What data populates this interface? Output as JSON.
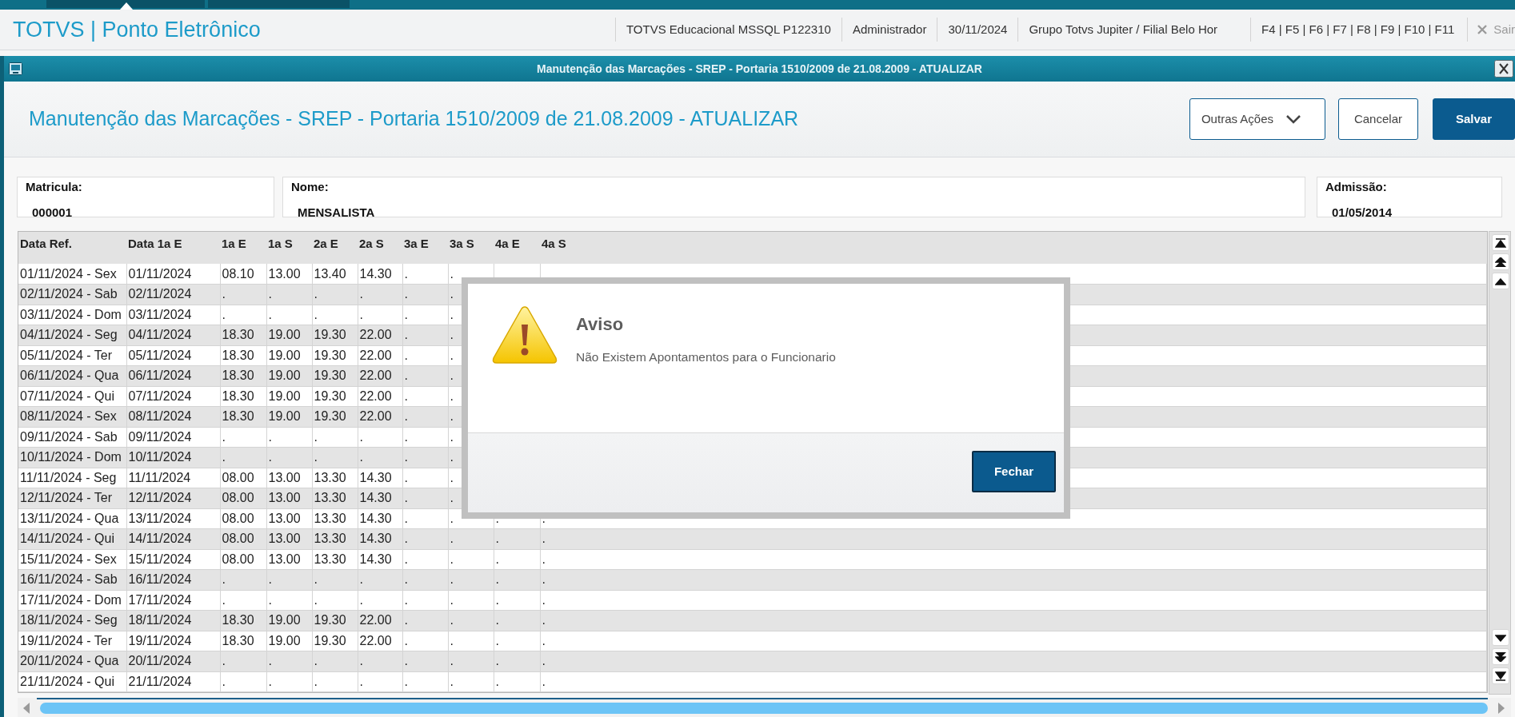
{
  "app": {
    "title": "TOTVS | Ponto Eletrônico",
    "info": [
      "TOTVS Educacional MSSQL P122310",
      "Administrador",
      "30/11/2024",
      "Grupo Totvs Jupiter / Filial Belo Hor",
      "F4 | F5 | F6 | F7 | F8 | F9 | F10 | F11"
    ],
    "exit": "Sair"
  },
  "window": {
    "title": "Manutenção das Marcações - SREP - Portaria 1510/2009 de 21.08.2009 - ATUALIZAR"
  },
  "form": {
    "title": "Manutenção das Marcações - SREP - Portaria 1510/2009 de 21.08.2009 - ATUALIZAR",
    "buttons": [
      {
        "label": "Outras Ações",
        "kind": "dropdown"
      },
      {
        "label": "Cancelar",
        "kind": "secondary"
      },
      {
        "label": "Salvar",
        "kind": "primary"
      }
    ]
  },
  "fields": [
    {
      "label": "Matricula:",
      "value": "000001"
    },
    {
      "label": "Nome:",
      "value": "MENSALISTA"
    },
    {
      "label": "Admissão:",
      "value": "01/05/2014"
    }
  ],
  "table": {
    "columns": [
      "Data Ref.",
      "Data 1a E",
      "1a E",
      "1a S",
      "2a E",
      "2a S",
      "3a E",
      "3a S",
      "4a E",
      "4a S"
    ],
    "rows": [
      [
        "01/11/2024 - Sex",
        "01/11/2024",
        "08.10",
        "13.00",
        "13.40",
        "14.30",
        ".",
        ".",
        null,
        null
      ],
      [
        "02/11/2024 - Sab",
        "02/11/2024",
        ".",
        ".",
        ".",
        ".",
        ".",
        ".",
        null,
        null
      ],
      [
        "03/11/2024 - Dom",
        "03/11/2024",
        ".",
        ".",
        ".",
        ".",
        ".",
        ".",
        null,
        null
      ],
      [
        "04/11/2024 - Seg",
        "04/11/2024",
        "18.30",
        "19.00",
        "19.30",
        "22.00",
        ".",
        ".",
        null,
        null
      ],
      [
        "05/11/2024 - Ter",
        "05/11/2024",
        "18.30",
        "19.00",
        "19.30",
        "22.00",
        ".",
        ".",
        null,
        null
      ],
      [
        "06/11/2024 - Qua",
        "06/11/2024",
        "18.30",
        "19.00",
        "19.30",
        "22.00",
        ".",
        ".",
        null,
        null
      ],
      [
        "07/11/2024 - Qui",
        "07/11/2024",
        "18.30",
        "19.00",
        "19.30",
        "22.00",
        ".",
        ".",
        null,
        null
      ],
      [
        "08/11/2024 - Sex",
        "08/11/2024",
        "18.30",
        "19.00",
        "19.30",
        "22.00",
        ".",
        ".",
        null,
        null
      ],
      [
        "09/11/2024 - Sab",
        "09/11/2024",
        ".",
        ".",
        ".",
        ".",
        ".",
        ".",
        null,
        null
      ],
      [
        "10/11/2024 - Dom",
        "10/11/2024",
        ".",
        ".",
        ".",
        ".",
        ".",
        ".",
        null,
        null
      ],
      [
        "11/11/2024 - Seg",
        "11/11/2024",
        "08.00",
        "13.00",
        "13.30",
        "14.30",
        ".",
        ".",
        null,
        null
      ],
      [
        "12/11/2024 - Ter",
        "12/11/2024",
        "08.00",
        "13.00",
        "13.30",
        "14.30",
        ".",
        ".",
        null,
        null
      ],
      [
        "13/11/2024 - Qua",
        "13/11/2024",
        "08.00",
        "13.00",
        "13.30",
        "14.30",
        ".",
        ".",
        ".",
        "."
      ],
      [
        "14/11/2024 - Qui",
        "14/11/2024",
        "08.00",
        "13.00",
        "13.30",
        "14.30",
        ".",
        ".",
        ".",
        "."
      ],
      [
        "15/11/2024 - Sex",
        "15/11/2024",
        "08.00",
        "13.00",
        "13.30",
        "14.30",
        ".",
        ".",
        ".",
        "."
      ],
      [
        "16/11/2024 - Sab",
        "16/11/2024",
        ".",
        ".",
        ".",
        ".",
        ".",
        ".",
        ".",
        "."
      ],
      [
        "17/11/2024 - Dom",
        "17/11/2024",
        ".",
        ".",
        ".",
        ".",
        ".",
        ".",
        ".",
        "."
      ],
      [
        "18/11/2024 - Seg",
        "18/11/2024",
        "18.30",
        "19.00",
        "19.30",
        "22.00",
        ".",
        ".",
        ".",
        "."
      ],
      [
        "19/11/2024 - Ter",
        "19/11/2024",
        "18.30",
        "19.00",
        "19.30",
        "22.00",
        ".",
        ".",
        ".",
        "."
      ],
      [
        "20/11/2024 - Qua",
        "20/11/2024",
        ".",
        ".",
        ".",
        ".",
        ".",
        ".",
        ".",
        "."
      ],
      [
        "21/11/2024 - Qui",
        "21/11/2024",
        ".",
        ".",
        ".",
        ".",
        ".",
        ".",
        ".",
        "."
      ]
    ]
  },
  "dialog": {
    "title": "Aviso",
    "message": "Não Existem Apontamentos para o Funcionario",
    "button": "Fechar"
  }
}
